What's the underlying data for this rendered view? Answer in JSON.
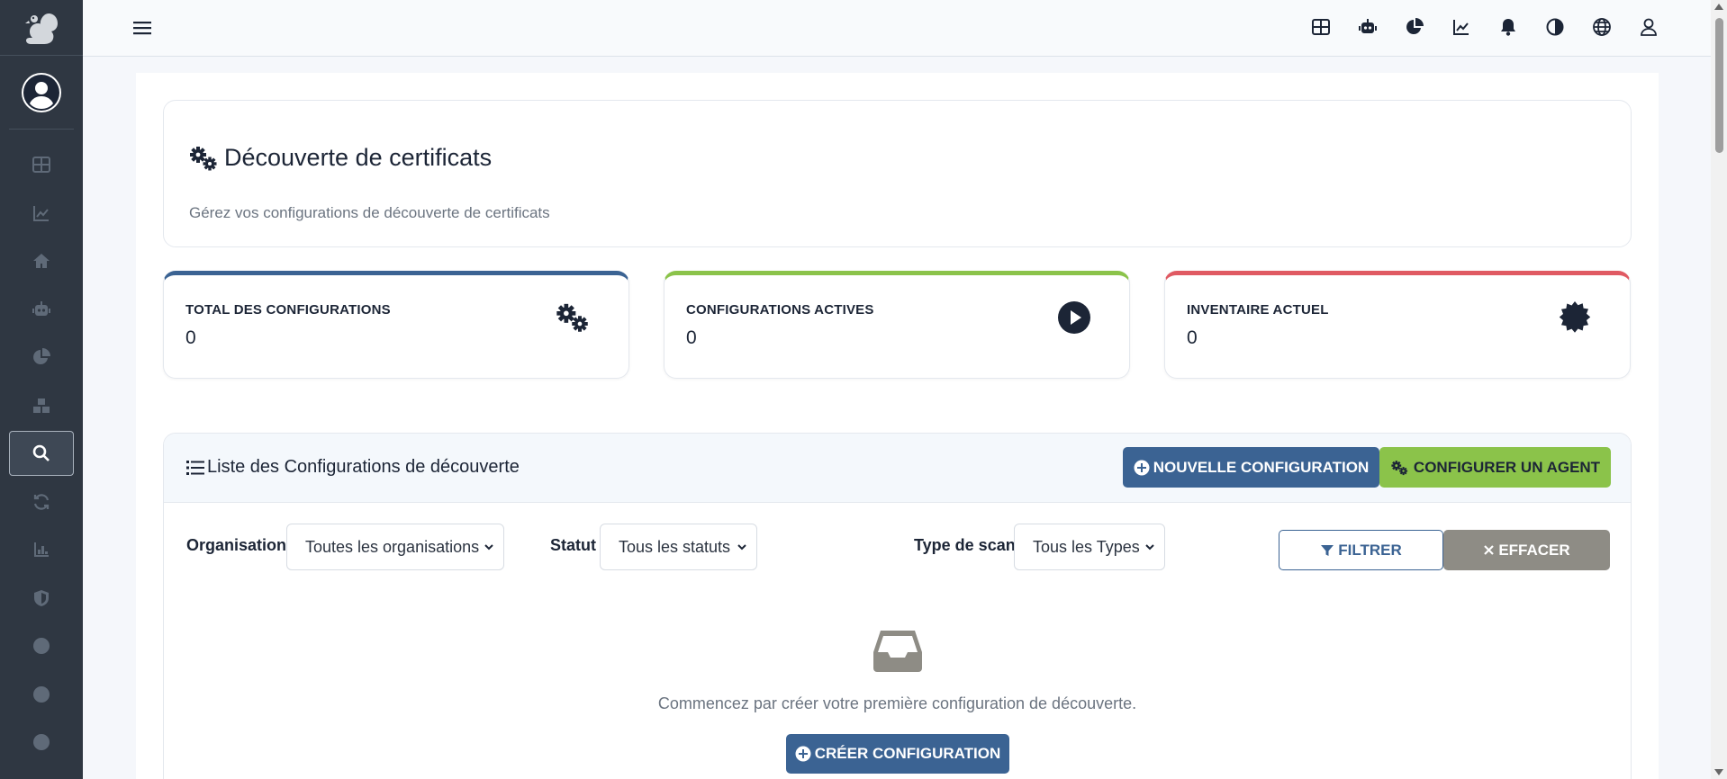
{
  "topbar": {
    "icons": [
      "grid-icon",
      "robot-icon",
      "pie-chart-icon",
      "line-chart-icon",
      "bell-icon",
      "contrast-icon",
      "globe-icon",
      "user-icon"
    ]
  },
  "sidebar": {
    "items": [
      {
        "icon": "grid-icon"
      },
      {
        "icon": "line-chart-icon"
      },
      {
        "icon": "home-icon"
      },
      {
        "icon": "robot-icon"
      },
      {
        "icon": "pie-chart-icon"
      },
      {
        "icon": "boxes-icon"
      },
      {
        "icon": "search-icon",
        "active": true
      },
      {
        "icon": "sync-icon"
      },
      {
        "icon": "bar-chart-icon"
      },
      {
        "icon": "shield-icon"
      },
      {
        "icon": "circle-icon"
      },
      {
        "icon": "circle-icon"
      },
      {
        "icon": "circle-icon"
      }
    ]
  },
  "page": {
    "title": "Découverte de certificats",
    "subtitle": "Gérez vos configurations de découverte de certificats"
  },
  "stats": [
    {
      "label": "TOTAL DES CONFIGURATIONS",
      "value": "0",
      "color": "#3b6393",
      "icon": "cogs-icon"
    },
    {
      "label": "CONFIGURATIONS ACTIVES",
      "value": "0",
      "color": "#8bc34a",
      "icon": "play-circle-icon"
    },
    {
      "label": "INVENTAIRE ACTUEL",
      "value": "0",
      "color": "#e05a63",
      "icon": "certificate-icon"
    }
  ],
  "list": {
    "title": "Liste des Configurations de découverte",
    "new_button": "NOUVELLE CONFIGURATION",
    "agent_button": "CONFIGURER UN AGENT",
    "filters": {
      "organisation_label": "Organisation",
      "organisation_value": "Toutes les organisations",
      "statut_label": "Statut",
      "statut_value": "Tous les statuts",
      "type_label": "Type de scan",
      "type_value": "Tous les Types",
      "filter_button": "FILTRER",
      "clear_button": "EFFACER"
    },
    "empty_message": "Commencez par créer votre première configuration de découverte.",
    "create_button": "CRÉER CONFIGURATION"
  },
  "colors": {
    "primary": "#3b6393",
    "success": "#8bc34a",
    "danger": "#e05a63",
    "sidebar": "#2f3742",
    "muted": "#8e8c85"
  }
}
